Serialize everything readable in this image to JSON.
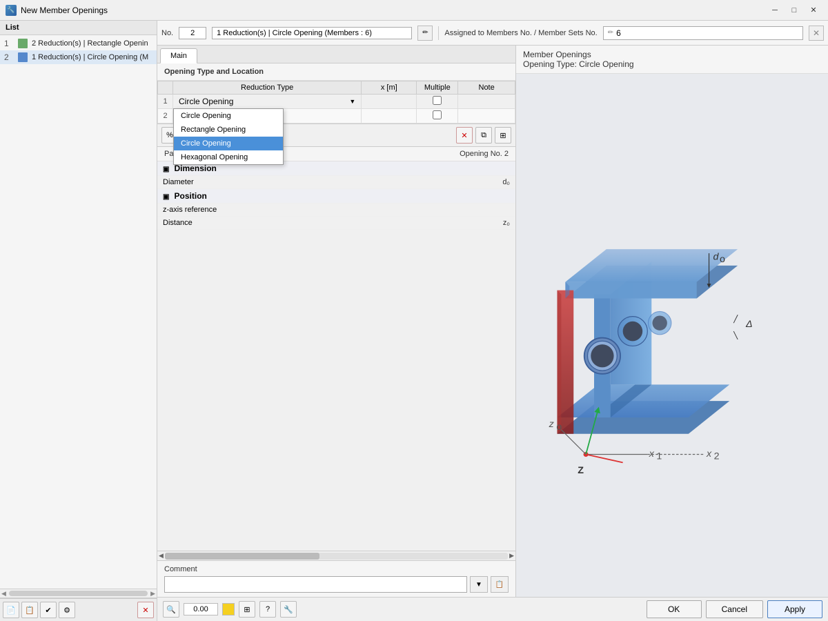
{
  "titleBar": {
    "title": "New Member Openings",
    "icon": "🔧",
    "minBtn": "─",
    "maxBtn": "□",
    "closeBtn": "✕"
  },
  "leftPanel": {
    "header": "List",
    "items": [
      {
        "num": "1",
        "color": "#6aaa6a",
        "text": "2 Reduction(s) | Rectangle Openin"
      },
      {
        "num": "2",
        "color": "#5588cc",
        "text": "1 Reduction(s) | Circle Opening (M"
      }
    ]
  },
  "topBar": {
    "noLabel": "No.",
    "noValue": "2",
    "nameValue": "1 Reduction(s) | Circle Opening (Members : 6)",
    "assignedLabel": "Assigned to Members No. / Member Sets No.",
    "assignedValue": "6",
    "penIcon": "✏️"
  },
  "tabs": [
    {
      "label": "Main",
      "active": true
    }
  ],
  "openingSection": {
    "title": "Opening Type and Location",
    "tableHeaders": [
      "",
      "Reduction Type",
      "x [m]",
      "Multiple",
      "Note"
    ],
    "rows": [
      {
        "num": "1",
        "type": "Circle Opening",
        "x": "",
        "multiple": false,
        "note": ""
      },
      {
        "num": "2",
        "type": "Rectangle Opening",
        "x": "",
        "multiple": false,
        "note": ""
      }
    ],
    "dropdownOpen": true,
    "dropdownRow": 1,
    "dropdownOptions": [
      {
        "label": "Circle Opening",
        "selected": true
      },
      {
        "label": "Rectangle Opening",
        "selected": false
      },
      {
        "label": "Circle Opening",
        "selected": false
      },
      {
        "label": "Hexagonal Opening",
        "selected": false
      }
    ]
  },
  "tableToolbar": {
    "percentBtn": "%",
    "sortBtn": "↧",
    "deleteBtn": "✕",
    "copyBtn1": "⧉",
    "copyBtn2": "⧉"
  },
  "parameters": {
    "title": "Parameters | Circle Opening",
    "openingNumLabel": "Opening No. 2",
    "groups": [
      {
        "label": "Dimension",
        "collapsed": false,
        "params": [
          {
            "label": "Diameter",
            "value": "d₀"
          }
        ]
      },
      {
        "label": "Position",
        "collapsed": false,
        "params": [
          {
            "label": "z-axis reference",
            "value": ""
          },
          {
            "label": "Distance",
            "value": "z₀"
          }
        ]
      }
    ]
  },
  "horizontalScroll": {
    "leftArrow": "◀",
    "rightArrow": "▶"
  },
  "comment": {
    "label": "Comment",
    "placeholder": "",
    "copyBtnLabel": "📋",
    "addBtnLabel": "📎"
  },
  "view3d": {
    "headerLine1": "Member Openings",
    "headerLine2": "Opening Type: Circle Opening"
  },
  "actionBar": {
    "bottomIcons": [
      "🔍",
      "0.00",
      "🟨",
      "⚙",
      "❓",
      "🔧"
    ],
    "okLabel": "OK",
    "cancelLabel": "Cancel",
    "applyLabel": "Apply"
  },
  "listToolbar": {
    "btn1": "📄",
    "btn2": "📋",
    "btn3": "✔",
    "btn4": "⚙",
    "deleteBtn": "✕"
  }
}
